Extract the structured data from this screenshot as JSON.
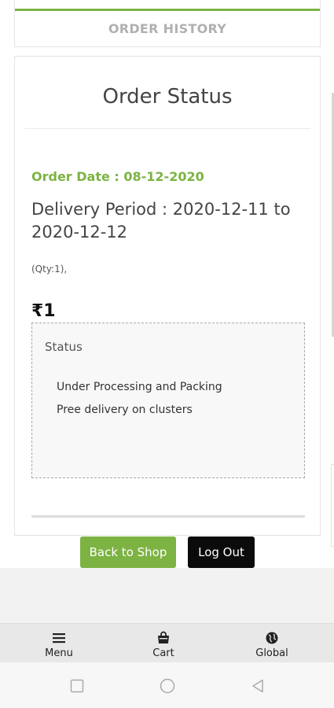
{
  "tabs": {
    "order_history": "ORDER HISTORY"
  },
  "order": {
    "title": "Order Status",
    "order_date": "Order Date : 08-12-2020",
    "delivery_period": "Delivery Period : 2020-12-11 to 2020-12-12",
    "qty": "(Qty:1),",
    "price": "₹1",
    "status": {
      "heading": "Status",
      "items": [
        "Under Processing and Packing",
        "Pree delivery on clusters"
      ]
    }
  },
  "actions": {
    "back_to_shop": "Back to Shop",
    "log_out": "Log Out"
  },
  "bottom_nav": {
    "items": [
      {
        "label": "Menu",
        "icon": "menu-icon"
      },
      {
        "label": "Cart",
        "icon": "cart-icon"
      },
      {
        "label": "Global",
        "icon": "globe-icon"
      }
    ]
  },
  "system_nav": {
    "icons": [
      "recent-apps-icon",
      "home-icon",
      "back-icon"
    ]
  },
  "colors": {
    "accent_green": "#7cb342",
    "logout_black": "#0b0b0b",
    "tab_label_grey": "#b0b0b0"
  }
}
